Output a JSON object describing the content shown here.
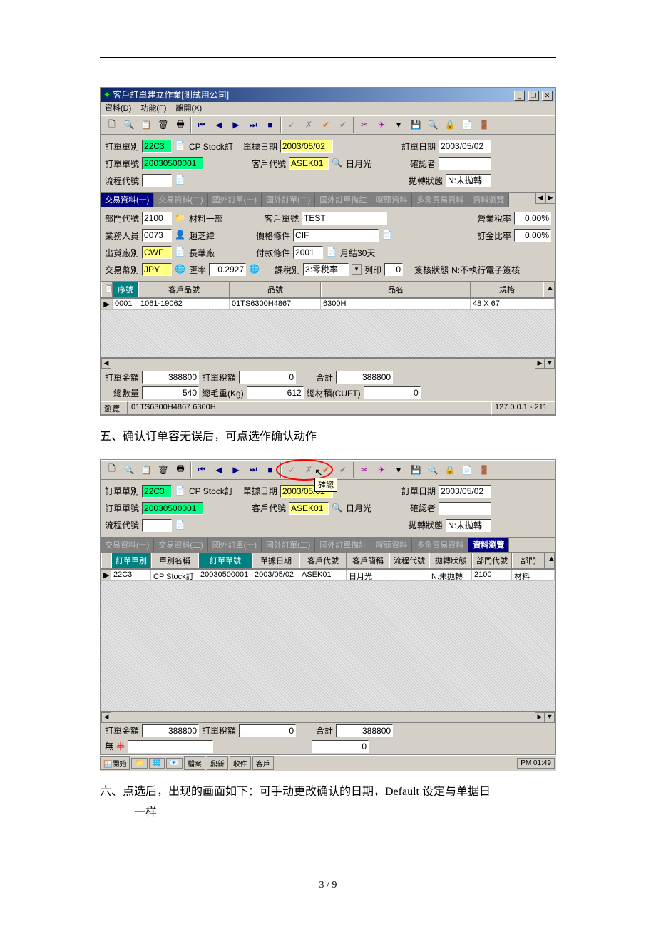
{
  "win1": {
    "title": "客戶訂單建立作業[測試用公司]",
    "menu": {
      "m1": "資料(D)",
      "m2": "功能(F)",
      "m3": "離開(X)"
    },
    "header": {
      "l_ordtype": "訂單單別",
      "v_ordtype": "22C3",
      "v_ordtype_desc": "CP Stock訂",
      "l_docdate": "單據日期",
      "v_docdate": "2003/05/02",
      "l_orddate": "訂單日期",
      "v_orddate": "2003/05/02",
      "l_ordno": "訂單單號",
      "v_ordno": "20030500001",
      "l_custcode": "客戶代號",
      "v_custcode": "ASEK01",
      "v_custname": "日月光",
      "l_confirm": "確認者",
      "v_confirm": "",
      "l_flowcode": "流程代號",
      "v_flowcode": "",
      "l_poststat": "拋轉狀態",
      "v_poststat": "N:未拋轉"
    },
    "tabs": [
      "交易資料(一)",
      "交易資料(二)",
      "國外訂單(一)",
      "國外訂單(二)",
      "國外訂單備註",
      "嘜頭資料",
      "多角貿易資料",
      "資料瀏覽"
    ],
    "trade": {
      "l_dept": "部門代號",
      "v_dept": "2100",
      "v_dept_name": "材料一部",
      "l_custordno": "客戶單號",
      "v_custordno": "TEST",
      "l_taxrate": "營業稅率",
      "v_taxrate": "0.00%",
      "l_sales": "業務人員",
      "v_sales": "0073",
      "v_sales_name": "趙芝緯",
      "l_priceterm": "價格條件",
      "v_priceterm": "CIF",
      "l_depositrate": "訂金比率",
      "v_depositrate": "0.00%",
      "l_shipfac": "出貨廠別",
      "v_shipfac": "CWE",
      "v_shipfac_name": "長華廠",
      "l_payterm": "付款條件",
      "v_payterm": "2001",
      "v_payterm_name": "月結30天",
      "l_curr": "交易幣別",
      "v_curr": "JPY",
      "l_rate": "匯率",
      "v_rate": "0.2927",
      "l_taxtype": "課稅別",
      "v_taxtype": "3:零稅率",
      "l_print": "列印",
      "v_print": "0",
      "l_signstat": "簽核狀態",
      "v_signstat": "N:不執行電子簽核"
    },
    "grid": {
      "cols": [
        "序號",
        "客戶品號",
        "品號",
        "品名",
        "規格"
      ],
      "row": {
        "seq": "0001",
        "custpn": "1061-19062",
        "pn": "01TS6300H4867",
        "name": "6300H",
        "spec": "48 X 67"
      }
    },
    "totals": {
      "l_amt": "訂單金額",
      "v_amt": "388800",
      "l_tax": "訂單稅額",
      "v_tax": "0",
      "l_total": "合計",
      "v_total": "388800",
      "l_qty": "總數量",
      "v_qty": "540",
      "l_gw": "總毛重(Kg)",
      "v_gw": "612",
      "l_cuft": "總材積(CUFT)",
      "v_cuft": "0"
    },
    "status": {
      "l_browse": "瀏覽",
      "v_browse": "01TS6300H4867 6300H",
      "ip": "127.0.0.1 - 211"
    }
  },
  "text5": "五、确认订单容无误后，可点选作确认动作",
  "tooltip": "確認",
  "win2": {
    "header": {
      "l_ordtype": "訂單單別",
      "v_ordtype": "22C3",
      "v_ordtype_desc": "CP Stock訂",
      "l_docdate": "單據日期",
      "v_docdate": "2003/05/02",
      "l_orddate": "訂單日期",
      "v_orddate": "2003/05/02",
      "l_ordno": "訂單單號",
      "v_ordno": "20030500001",
      "l_custcode": "客戶代號",
      "v_custcode": "ASEK01",
      "v_custname": "日月光",
      "l_confirm": "確認者",
      "v_confirm": "",
      "l_flowcode": "流程代號",
      "v_flowcode": "",
      "l_poststat": "拋轉狀態",
      "v_poststat": "N:未拋轉"
    },
    "tabs": [
      "交易資料(一)",
      "交易資料(二)",
      "國外訂單(一)",
      "國外訂單(二)",
      "國外訂單備註",
      "嘜頭資料",
      "多角貿易資料",
      "資料瀏覽"
    ],
    "grid": {
      "cols": [
        "訂單單別",
        "單別名稱",
        "訂單單號",
        "單據日期",
        "客戶代號",
        "客戶簡稱",
        "流程代號",
        "拋轉狀態",
        "部門代號",
        "部門"
      ],
      "row": {
        "c0": "22C3",
        "c1": "CP Stock訂",
        "c2": "20030500001",
        "c3": "2003/05/02",
        "c4": "ASEK01",
        "c5": "日月光",
        "c6": "",
        "c7": "N:未拋轉",
        "c8": "2100",
        "c9": "材料"
      }
    },
    "totals": {
      "l_amt": "訂單金額",
      "v_amt": "388800",
      "l_tax": "訂單稅額",
      "v_tax": "0",
      "l_total": "合計",
      "v_total": "388800",
      "l_none": "無",
      "l_half": "半",
      "v2": "0"
    }
  },
  "text6": "六、点选后，出现的画面如下：可手动更改确认的日期，Default 设定与单据日",
  "text6b": "一样",
  "pagenum": "3 / 9"
}
